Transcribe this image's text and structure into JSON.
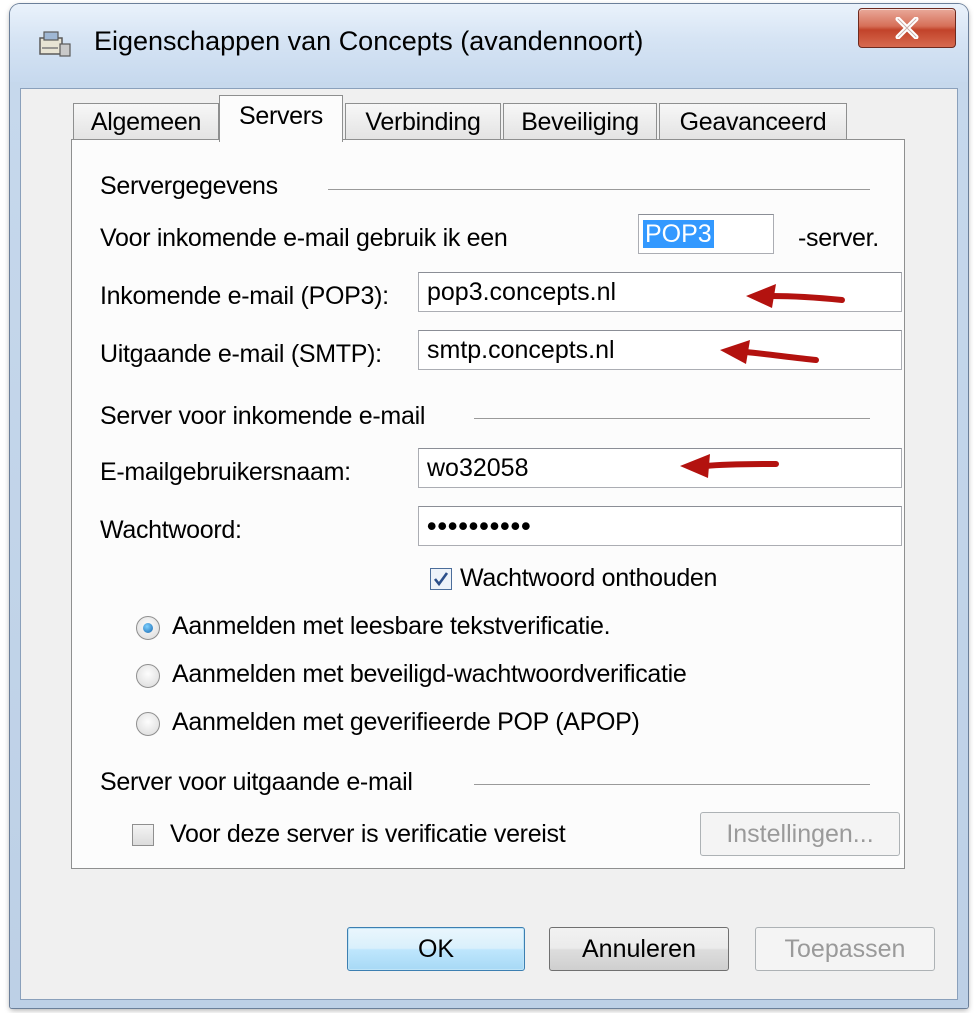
{
  "window": {
    "title": "Eigenschappen van Concepts (avandennoort)",
    "close_glyph": "X"
  },
  "tabs": [
    {
      "label": "Algemeen",
      "active": false
    },
    {
      "label": "Servers",
      "active": true
    },
    {
      "label": "Verbinding",
      "active": false
    },
    {
      "label": "Beveiliging",
      "active": false
    },
    {
      "label": "Geavanceerd",
      "active": false
    }
  ],
  "server_info": {
    "group_label": "Servergegevens",
    "incoming_type_prefix": "Voor inkomende e-mail gebruik ik een",
    "incoming_type_value": "POP3",
    "incoming_type_suffix": "-server.",
    "incoming_label": "Inkomende e-mail (POP3):",
    "incoming_value": "pop3.concepts.nl",
    "outgoing_label": "Uitgaande e-mail (SMTP):",
    "outgoing_value": "smtp.concepts.nl"
  },
  "incoming_server": {
    "group_label": "Server voor inkomende e-mail",
    "username_label": "E-mailgebruikersnaam:",
    "username_value": "wo32058",
    "password_label": "Wachtwoord:",
    "password_value": "••••••••••",
    "remember_label": "Wachtwoord onthouden",
    "remember_checked": true,
    "auth_options": [
      {
        "label": "Aanmelden met leesbare tekstverificatie.",
        "selected": true
      },
      {
        "label": "Aanmelden met beveiligd-wachtwoordverificatie",
        "selected": false
      },
      {
        "label": "Aanmelden met geverifieerde POP (APOP)",
        "selected": false
      }
    ]
  },
  "outgoing_server": {
    "group_label": "Server voor uitgaande e-mail",
    "auth_required_label": "Voor deze server is verificatie vereist",
    "auth_required_checked": false,
    "settings_button": "Instellingen..."
  },
  "buttons": {
    "ok": "OK",
    "cancel": "Annuleren",
    "apply": "Toepassen"
  },
  "colors": {
    "selection": "#3399ff",
    "arrow": "#b3120f",
    "close_button": "#c2432a"
  },
  "icons": {
    "window": "mail-account-icon",
    "close": "close-icon",
    "arrow": "red-arrow-annotation"
  }
}
